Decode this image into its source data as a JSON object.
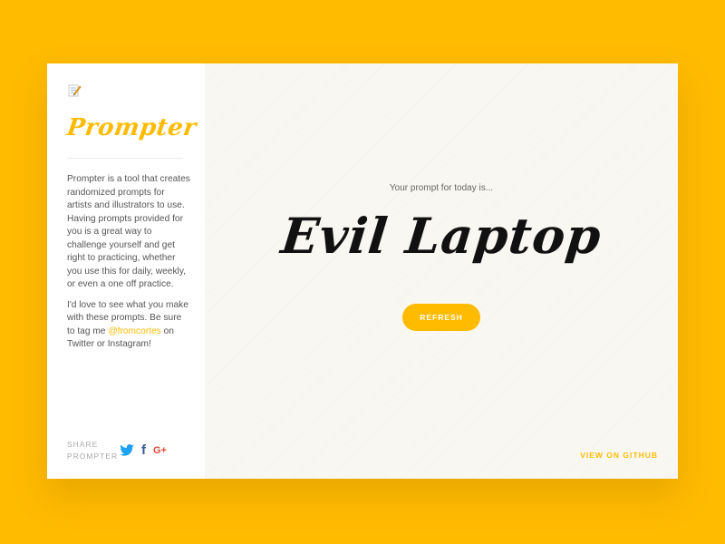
{
  "sidebar": {
    "brand": "Prompter",
    "description": "Prompter is a tool that creates randomized prompts for artists and illustrators to use. Having prompts provided for you is a great way to challenge yourself and get right to practicing, whether you use this for daily, weekly, or even a one off practice.",
    "share_text_before": "I'd love to see what you make with these prompts. Be sure to tag me ",
    "handle": "@fromcortes",
    "share_text_after": " on Twitter or Instagram!",
    "share_label_line1": "SHARE",
    "share_label_line2": "PROMPTER",
    "social": {
      "facebook": "f",
      "google": "G+"
    }
  },
  "main": {
    "intro": "Your prompt for today is...",
    "prompt": "Evil Laptop",
    "refresh_label": "REFRESH",
    "github_label": "VIEW ON GITHUB"
  },
  "colors": {
    "background": "#FFBB00",
    "accent": "#FFBB00",
    "panel": "#F9F7F1",
    "twitter": "#1DA1F2",
    "facebook": "#3B5998",
    "google": "#DD4B39"
  },
  "icons": {
    "logo": "memo-pencil-icon",
    "twitter": "twitter-bird-icon",
    "facebook": "facebook-icon",
    "google": "google-plus-icon"
  }
}
